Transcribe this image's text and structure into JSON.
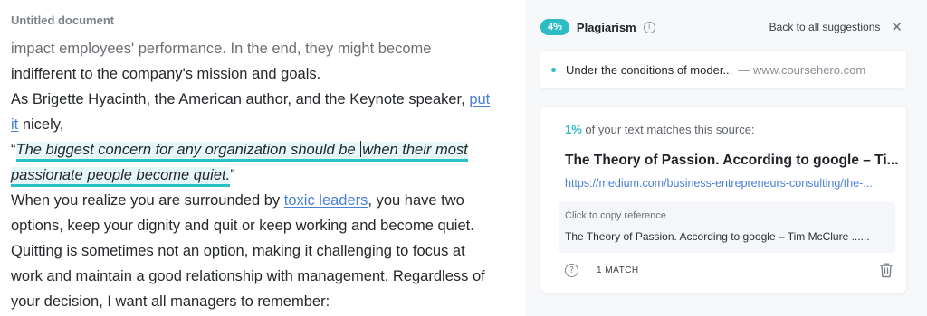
{
  "document": {
    "title": "Untitled document",
    "lines": {
      "l1": "impact employees' performance. In the end, they might become",
      "l2": "indifferent to the company's mission and goals.",
      "l3a": "As Brigette Hyacinth, the American author, and the Keynote speaker, ",
      "l3link": "put",
      "l4link": "it",
      "l4b": " nicely,",
      "q_open": "“",
      "q1a": "The biggest concern for any organization should be ",
      "q1b": "when their most",
      "q2": "passionate people become quiet.",
      "q_close": "”",
      "l7a": "When you realize you are surrounded by ",
      "l7link": "toxic leaders",
      "l7b": ", you have two",
      "l8": "options, keep your dignity and quit or keep working and become quiet.",
      "l9": "Quitting is sometimes not an option, making it challenging to focus at",
      "l10": "work and maintain a good relationship with management. Regardless of",
      "l11": "your decision, I want all managers to remember:"
    }
  },
  "panel": {
    "badge": "4%",
    "title": "Plagiarism",
    "info_icon": "ⓘ",
    "back_label": "Back to all suggestions",
    "close_icon": "✕",
    "summary": {
      "snippet": "Under the conditions of moder...",
      "domain": "— www.coursehero.com"
    },
    "source": {
      "percent": "1%",
      "match_text": " of your text matches this source:",
      "title": "The Theory of Passion. According to google – Ti...",
      "url": "https://medium.com/business-entrepreneurs-consulting/the-...",
      "copy_label": "Click to copy reference",
      "reference": "The Theory of Passion. According to google – Tim McClure ......",
      "help_icon": "?",
      "match_count": "1 MATCH"
    }
  },
  "colors": {
    "accent": "#2dbcc4",
    "link": "#4a7fd6"
  }
}
